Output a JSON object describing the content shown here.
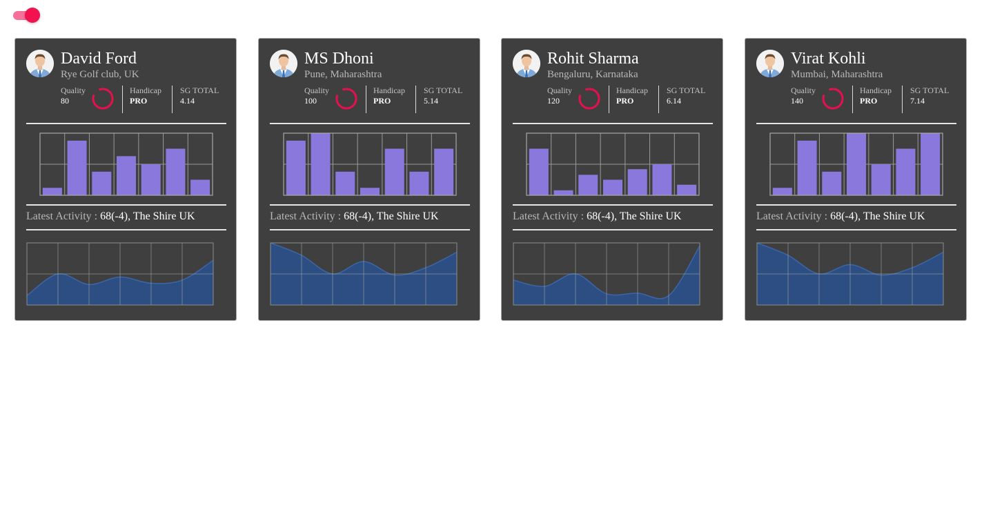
{
  "toggle": {
    "state": "on",
    "track_color": "#f7709a",
    "knob_color": "#f2124f"
  },
  "labels": {
    "quality": "Quality",
    "handicap": "Handicap",
    "sg_total": "SG TOTAL",
    "latest_activity": "Latest Activity : "
  },
  "colors": {
    "card_bg": "#3f3f3f",
    "bar_fill": "#8a78dc",
    "area_fill": "#2c4e82",
    "ring_color": "#e8104c"
  },
  "cards": [
    {
      "name": "David Ford",
      "location": "Rye Golf club, UK",
      "quality": "80",
      "handicap": "PRO",
      "sg_total": "4.14",
      "activity": "68(-4), The Shire UK",
      "chart_data": [
        {
          "type": "bar",
          "values": [
            12,
            88,
            38,
            63,
            50,
            75,
            25
          ],
          "ylim": [
            0,
            100
          ]
        },
        {
          "type": "area",
          "values": [
            15,
            50,
            33,
            45,
            35,
            40,
            72
          ],
          "ylim": [
            0,
            100
          ]
        }
      ]
    },
    {
      "name": "MS Dhoni",
      "location": "Pune, Maharashtra",
      "quality": "100",
      "handicap": "PRO",
      "sg_total": "5.14",
      "activity": "68(-4), The Shire UK",
      "chart_data": [
        {
          "type": "bar",
          "values": [
            88,
            100,
            38,
            12,
            75,
            38,
            75
          ],
          "ylim": [
            0,
            100
          ]
        },
        {
          "type": "area",
          "values": [
            100,
            80,
            50,
            70,
            48,
            60,
            85
          ],
          "ylim": [
            0,
            100
          ]
        }
      ]
    },
    {
      "name": "Rohit Sharma",
      "location": "Bengaluru, Karnataka",
      "quality": "120",
      "handicap": "PRO",
      "sg_total": "6.14",
      "activity": "68(-4), The Shire UK",
      "chart_data": [
        {
          "type": "bar",
          "values": [
            75,
            8,
            33,
            25,
            42,
            50,
            17
          ],
          "ylim": [
            0,
            100
          ]
        },
        {
          "type": "area",
          "values": [
            40,
            30,
            50,
            18,
            19,
            15,
            95
          ],
          "ylim": [
            0,
            100
          ]
        }
      ]
    },
    {
      "name": "Virat Kohli",
      "location": "Mumbai, Maharashtra",
      "quality": "140",
      "handicap": "PRO",
      "sg_total": "7.14",
      "activity": "68(-4), The Shire UK",
      "chart_data": [
        {
          "type": "bar",
          "values": [
            12,
            88,
            38,
            100,
            50,
            75,
            100
          ],
          "ylim": [
            0,
            100
          ]
        },
        {
          "type": "area",
          "values": [
            100,
            80,
            50,
            65,
            48,
            60,
            85
          ],
          "ylim": [
            0,
            100
          ]
        }
      ]
    }
  ]
}
